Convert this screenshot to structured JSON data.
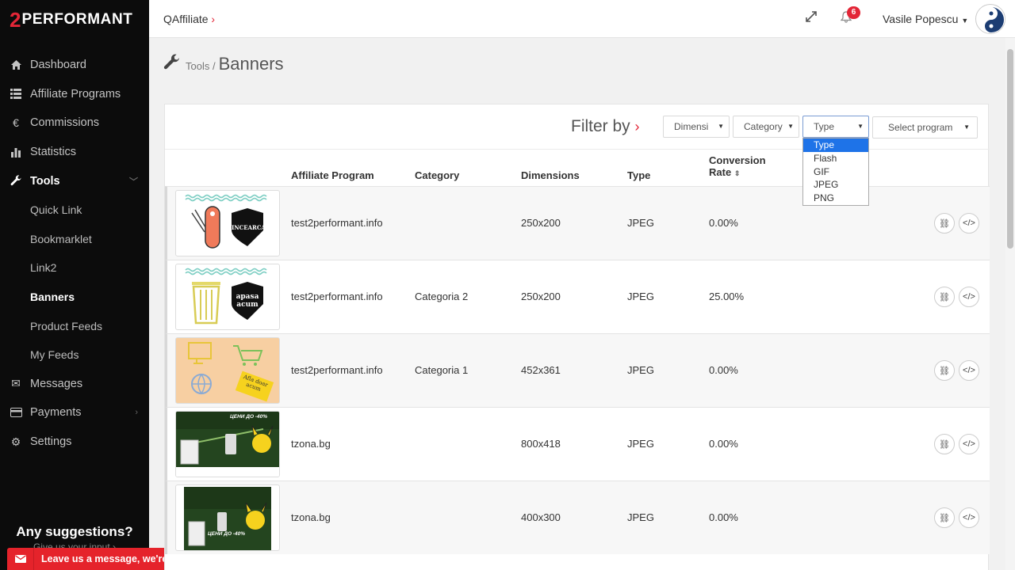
{
  "brand": {
    "num": "2",
    "word": "PERFORMANT"
  },
  "nav": [
    {
      "label": "Dashboard",
      "icon": "home-icon",
      "glyph": "⌂"
    },
    {
      "label": "Affiliate Programs",
      "icon": "list-icon",
      "glyph": "☰"
    },
    {
      "label": "Commissions",
      "icon": "euro-icon",
      "glyph": "€"
    },
    {
      "label": "Statistics",
      "icon": "bar-chart-icon",
      "glyph": "▮"
    },
    {
      "label": "Tools",
      "icon": "wrench-icon",
      "glyph": "🔧"
    },
    {
      "label": "Quick Link"
    },
    {
      "label": "Bookmarklet"
    },
    {
      "label": "Link2"
    },
    {
      "label": "Banners"
    },
    {
      "label": "Product Feeds"
    },
    {
      "label": "My Feeds"
    },
    {
      "label": "Messages",
      "icon": "envelope-icon",
      "glyph": "✉"
    },
    {
      "label": "Payments",
      "icon": "credit-card-icon",
      "glyph": "▭"
    },
    {
      "label": "Settings",
      "icon": "gear-icon",
      "glyph": "⚙"
    }
  ],
  "suggest": {
    "title": "Any suggestions?",
    "sub": "Give us your input ›"
  },
  "message_bar": "Leave us a message, we're very ch...",
  "header": {
    "crumb": "QAffiliate",
    "notifications": "6",
    "user": "Vasile Popescu"
  },
  "page": {
    "parent": "Tools /",
    "title": "Banners"
  },
  "filter": {
    "label": "Filter by",
    "dimension": "Dimensi",
    "category": "Category",
    "type": "Type",
    "program": "Select program",
    "type_options": [
      "Type",
      "Flash",
      "GIF",
      "JPEG",
      "PNG"
    ]
  },
  "columns": {
    "program": "Affiliate Program",
    "category": "Category",
    "dimensions": "Dimensions",
    "type": "Type",
    "conversion_1": "Conversion",
    "conversion_2": "Rate"
  },
  "banners": [
    {
      "program": "test2performant.info",
      "category": "",
      "dimensions": "250x200",
      "type": "JPEG",
      "rate": "0.00%",
      "thumb_text": "INCEARCA"
    },
    {
      "program": "test2performant.info",
      "category": "Categoria 2",
      "dimensions": "250x200",
      "type": "JPEG",
      "rate": "25.00%",
      "thumb_text": "apasa acum"
    },
    {
      "program": "test2performant.info",
      "category": "Categoria 1",
      "dimensions": "452x361",
      "type": "JPEG",
      "rate": "0.00%",
      "thumb_text": "Afla doar acum"
    },
    {
      "program": "tzona.bg",
      "category": "",
      "dimensions": "800x418",
      "type": "JPEG",
      "rate": "0.00%",
      "thumb_text": "ЦЕНИ ДО -40%"
    },
    {
      "program": "tzona.bg",
      "category": "",
      "dimensions": "400x300",
      "type": "JPEG",
      "rate": "0.00%",
      "thumb_text": "ЦЕНИ ДО -40%"
    }
  ],
  "colors": {
    "brand_red": "#e32637",
    "sidebar_bg": "#0c0c0c",
    "highlight_blue": "#1e73e8"
  }
}
